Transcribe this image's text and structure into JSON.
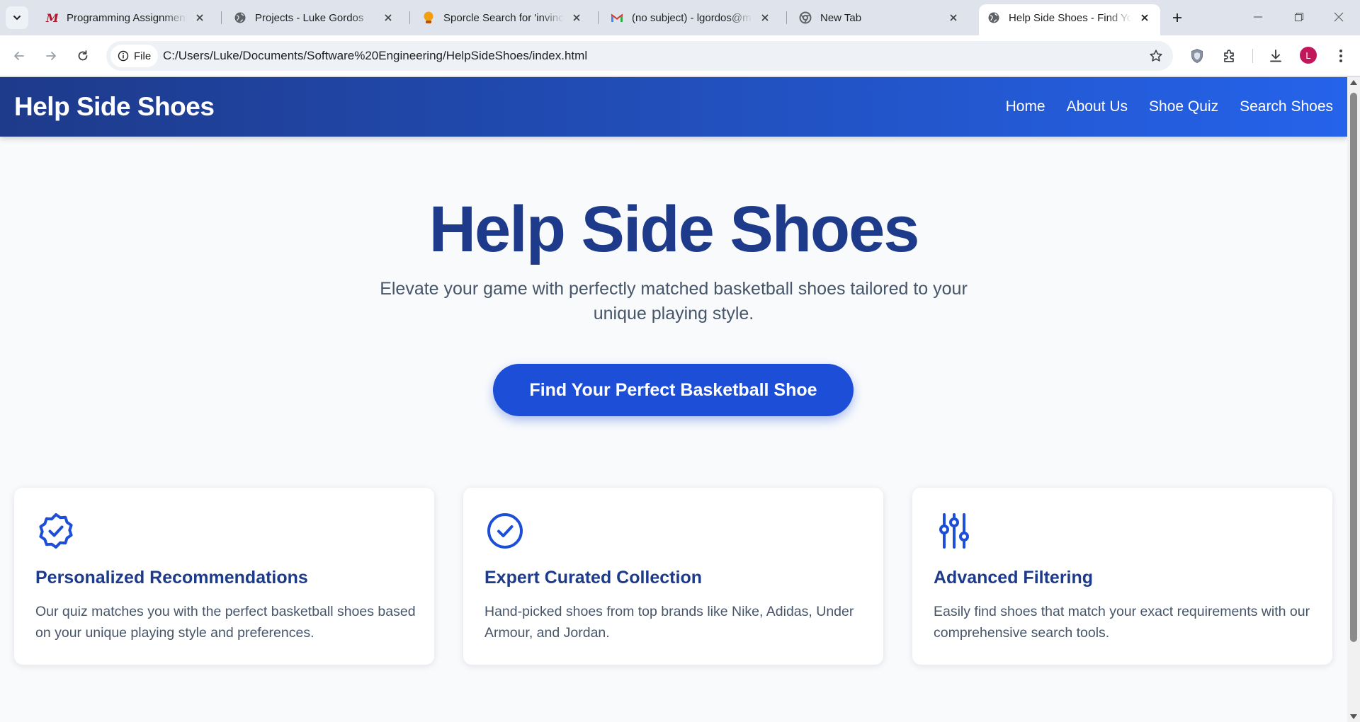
{
  "browser": {
    "tabs": [
      {
        "title": "Programming Assignment",
        "icon": "canvas-m-icon"
      },
      {
        "title": "Projects - Luke Gordos",
        "icon": "globe-icon"
      },
      {
        "title": "Sporcle Search for 'invincible'",
        "icon": "sporcle-icon"
      },
      {
        "title": "(no subject) - lgordos@mu",
        "icon": "gmail-icon"
      },
      {
        "title": "New Tab",
        "icon": "chrome-icon"
      },
      {
        "title": "Help Side Shoes - Find Your",
        "icon": "globe-icon",
        "active": true
      }
    ],
    "address": {
      "chip_label": "File",
      "url": "C:/Users/Luke/Documents/Software%20Engineering/HelpSideShoes/index.html"
    },
    "profile_initial": "L"
  },
  "site": {
    "brand": "Help Side Shoes",
    "nav": [
      "Home",
      "About Us",
      "Shoe Quiz",
      "Search Shoes"
    ],
    "hero": {
      "title": "Help Side Shoes",
      "subtitle": "Elevate your game with perfectly matched basketball shoes tailored to your unique playing style.",
      "cta": "Find Your Perfect Basketball Shoe"
    },
    "features": [
      {
        "icon": "badge-check-icon",
        "title": "Personalized Recommendations",
        "text": "Our quiz matches you with the perfect basketball shoes based on your unique playing style and preferences."
      },
      {
        "icon": "circle-check-icon",
        "title": "Expert Curated Collection",
        "text": "Hand-picked shoes from top brands like Nike, Adidas, Under Armour, and Jordan."
      },
      {
        "icon": "sliders-icon",
        "title": "Advanced Filtering",
        "text": "Easily find shoes that match your exact requirements with our comprehensive search tools."
      }
    ]
  },
  "colors": {
    "primary": "#1d4ed8",
    "heading": "#1e3a8a",
    "header_gradient_start": "#1e3a8a",
    "header_gradient_end": "#2563eb",
    "body_text": "#475569",
    "page_bg": "#f8fafc"
  }
}
